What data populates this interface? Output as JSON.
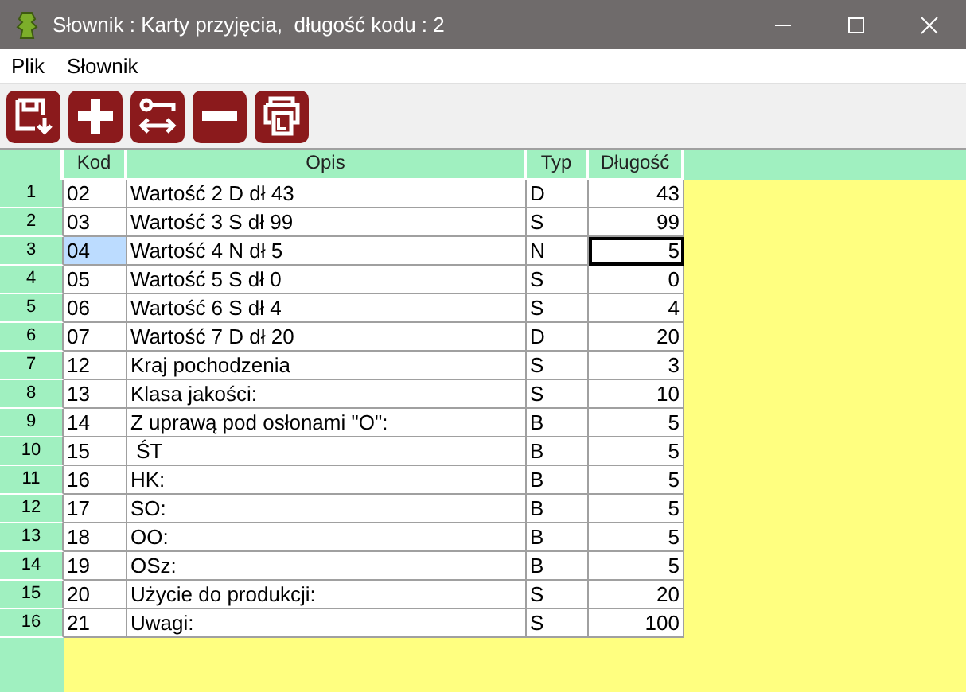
{
  "window": {
    "title": "Słownik : Karty przyjęcia,  długość kodu : 2"
  },
  "menu": [
    "Plik",
    "Słownik"
  ],
  "toolbar": [
    {
      "kind": "save"
    },
    {
      "kind": "add"
    },
    {
      "kind": "swap"
    },
    {
      "kind": "remove"
    },
    {
      "kind": "print"
    }
  ],
  "table": {
    "columns": [
      "Kod",
      "Opis",
      "Typ",
      "Długość"
    ],
    "rows": [
      {
        "number": "1",
        "kod": "02",
        "opis": "Wartość 2 D dł 43",
        "typ": "D",
        "dlugosc": "43",
        "selected": false
      },
      {
        "number": "2",
        "kod": "03",
        "opis": "Wartość 3 S dł 99",
        "typ": "S",
        "dlugosc": "99",
        "selected": false
      },
      {
        "number": "3",
        "kod": "04",
        "opis": "Wartość 4 N dł 5",
        "typ": "N",
        "dlugosc": "5",
        "selected": true
      },
      {
        "number": "4",
        "kod": "05",
        "opis": "Wartość 5 S dł 0",
        "typ": "S",
        "dlugosc": "0",
        "selected": false
      },
      {
        "number": "5",
        "kod": "06",
        "opis": "Wartość 6 S dł 4",
        "typ": "S",
        "dlugosc": "4",
        "selected": false
      },
      {
        "number": "6",
        "kod": "07",
        "opis": "Wartość 7 D dł 20",
        "typ": "D",
        "dlugosc": "20",
        "selected": false
      },
      {
        "number": "7",
        "kod": "12",
        "opis": "Kraj pochodzenia",
        "typ": "S",
        "dlugosc": "3",
        "selected": false
      },
      {
        "number": "8",
        "kod": "13",
        "opis": "Klasa jakości:",
        "typ": "S",
        "dlugosc": "10",
        "selected": false
      },
      {
        "number": "9",
        "kod": "14",
        "opis": "Z uprawą pod osłonami \"O\":",
        "typ": "B",
        "dlugosc": "5",
        "selected": false
      },
      {
        "number": "10",
        "kod": "15",
        "opis": " ŚT",
        "typ": "B",
        "dlugosc": "5",
        "selected": false
      },
      {
        "number": "11",
        "kod": "16",
        "opis": "HK:",
        "typ": "B",
        "dlugosc": "5",
        "selected": false
      },
      {
        "number": "12",
        "kod": "17",
        "opis": "SO:",
        "typ": "B",
        "dlugosc": "5",
        "selected": false
      },
      {
        "number": "13",
        "kod": "18",
        "opis": "OO:",
        "typ": "B",
        "dlugosc": "5",
        "selected": false
      },
      {
        "number": "14",
        "kod": "19",
        "opis": "OSz:",
        "typ": "B",
        "dlugosc": "5",
        "selected": false
      },
      {
        "number": "15",
        "kod": "20",
        "opis": "Użycie do produkcji:",
        "typ": "S",
        "dlugosc": "20",
        "selected": false
      },
      {
        "number": "16",
        "kod": "21",
        "opis": "Uwagi:",
        "typ": "S",
        "dlugosc": "100",
        "selected": false
      }
    ]
  }
}
